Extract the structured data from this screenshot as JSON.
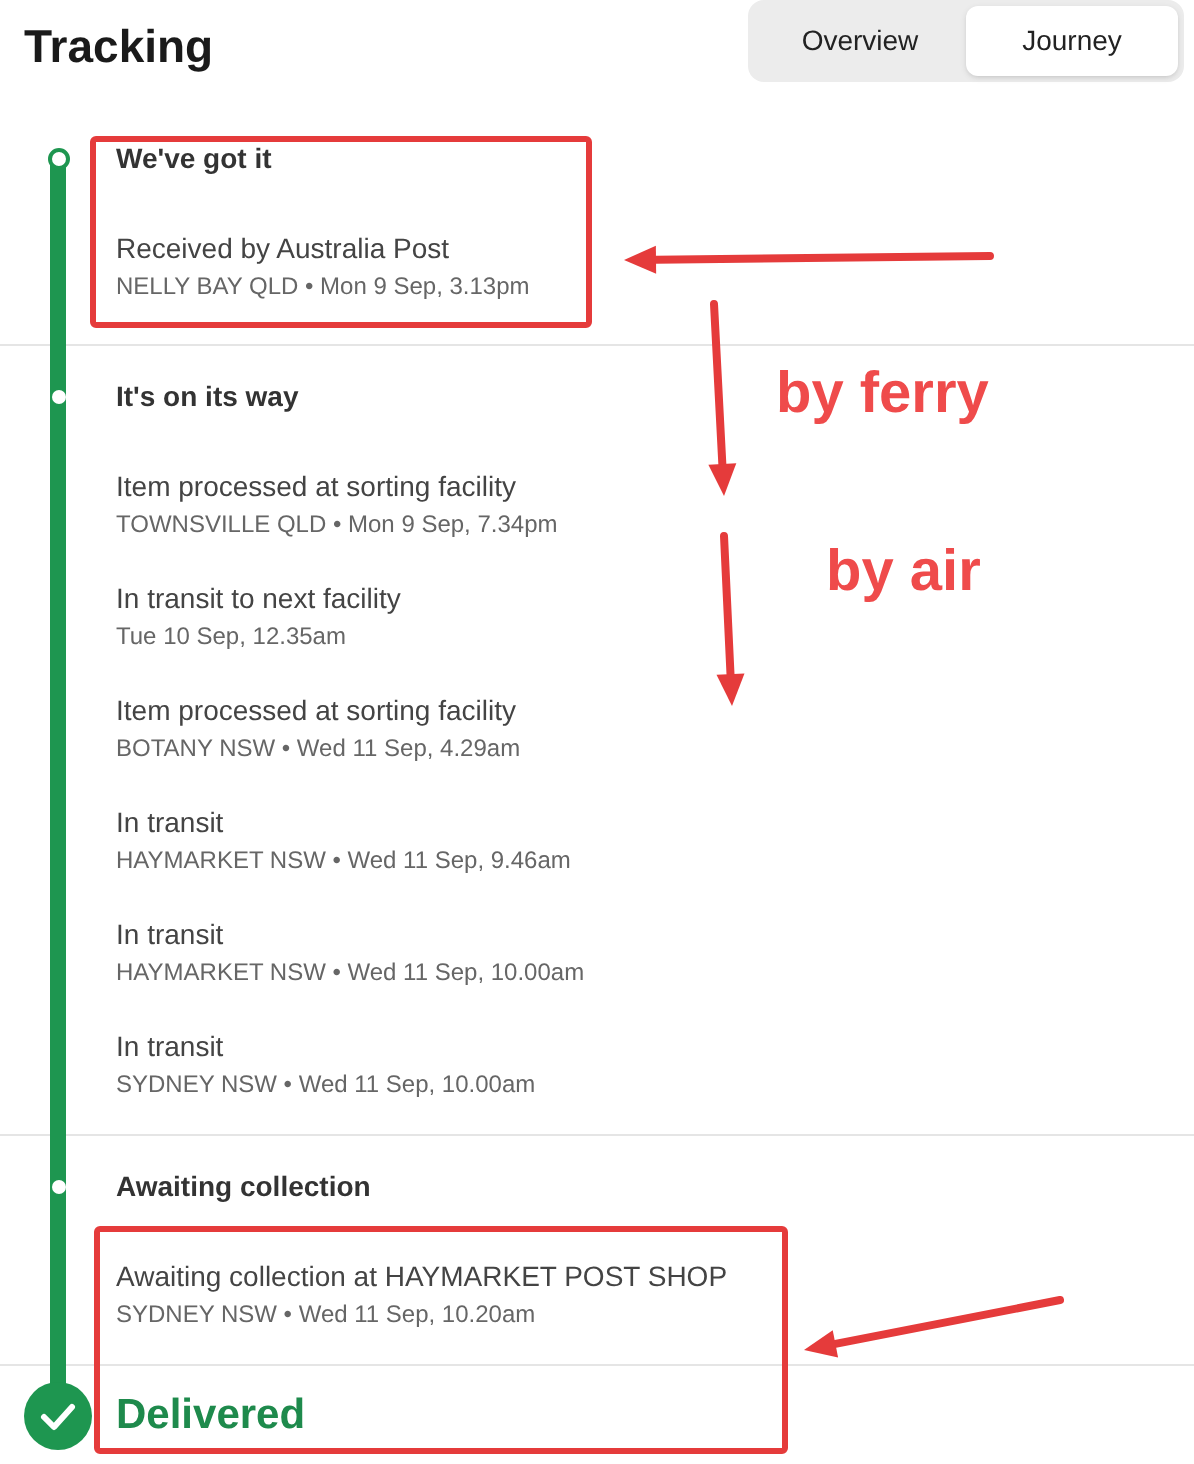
{
  "title": "Tracking",
  "tabs": [
    {
      "label": "Overview",
      "selected": false
    },
    {
      "label": "Journey",
      "selected": true
    }
  ],
  "sections": [
    {
      "heading": "We've got it",
      "kind": "dot",
      "events": [
        {
          "title": "Received by Australia Post",
          "meta": "NELLY BAY QLD • Mon 9 Sep, 3.13pm"
        }
      ]
    },
    {
      "heading": "It's on its way",
      "kind": "dot",
      "events": [
        {
          "title": "Item processed at sorting facility",
          "meta": "TOWNSVILLE QLD • Mon 9 Sep, 7.34pm"
        },
        {
          "title": "In transit to next facility",
          "meta": "Tue 10 Sep, 12.35am"
        },
        {
          "title": "Item processed at sorting facility",
          "meta": "BOTANY NSW • Wed 11 Sep, 4.29am"
        },
        {
          "title": "In transit",
          "meta": "HAYMARKET NSW • Wed 11 Sep, 9.46am"
        },
        {
          "title": "In transit",
          "meta": "HAYMARKET NSW • Wed 11 Sep, 10.00am"
        },
        {
          "title": "In transit",
          "meta": "SYDNEY NSW • Wed 11 Sep, 10.00am"
        }
      ]
    },
    {
      "heading": "Awaiting collection",
      "kind": "dot",
      "events": [
        {
          "title": "Awaiting collection at HAYMARKET POST SHOP",
          "meta": "SYDNEY NSW • Wed 11 Sep, 10.20am"
        }
      ]
    },
    {
      "heading": "Delivered",
      "kind": "check"
    }
  ],
  "annotations": [
    {
      "text": "by ferry"
    },
    {
      "text": "by air"
    }
  ]
}
